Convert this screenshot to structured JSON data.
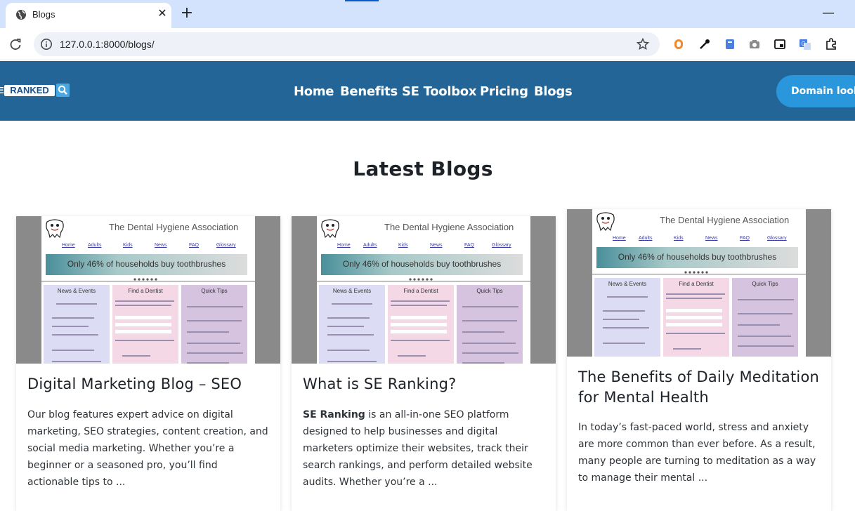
{
  "browser": {
    "tab_title": "Blogs",
    "url": "127.0.0.1:8000/blogs/",
    "close_glyph": "✕",
    "newtab_glyph": "+",
    "minimize_glyph": "—"
  },
  "header": {
    "logo_text": "RANKED",
    "logo_prefix": "E",
    "nav": [
      "Home",
      "Benefits",
      "SE Toolbox",
      "Pricing",
      "Blogs"
    ],
    "cta_label": "Domain lookup"
  },
  "main": {
    "title": "Latest Blogs",
    "cards": [
      {
        "title": "Digital Marketing Blog – SEO",
        "excerpt": "Our blog features expert advice on digital marketing, SEO strategies, content creation, and social media marketing. Whether you’re a beginner or a seasoned pro, you’ll find actionable tips to ..."
      },
      {
        "title": "What is SE Ranking?",
        "excerpt_bold": "SE Ranking",
        "excerpt": " is an all-in-one SEO platform designed to help businesses and digital marketers optimize their websites, track their search rankings, and perform detailed website audits. Whether you’re a ..."
      },
      {
        "title": "The Benefits of Daily Meditation for Mental Health",
        "excerpt": "In today’s fast-paced world, stress and anxiety are more common than ever before. As a result, many people are turning to meditation as a way to manage their mental ..."
      }
    ],
    "thumbnail": {
      "site_name": "The Dental Hygiene Association",
      "menu": [
        "Home",
        "Adults",
        "Kids",
        "News",
        "FAQ",
        "Glossary"
      ],
      "banner": "Only 46% of households buy toothbrushes",
      "columns": [
        "News & Events",
        "Find a Dentist",
        "Quick Tips"
      ]
    }
  }
}
